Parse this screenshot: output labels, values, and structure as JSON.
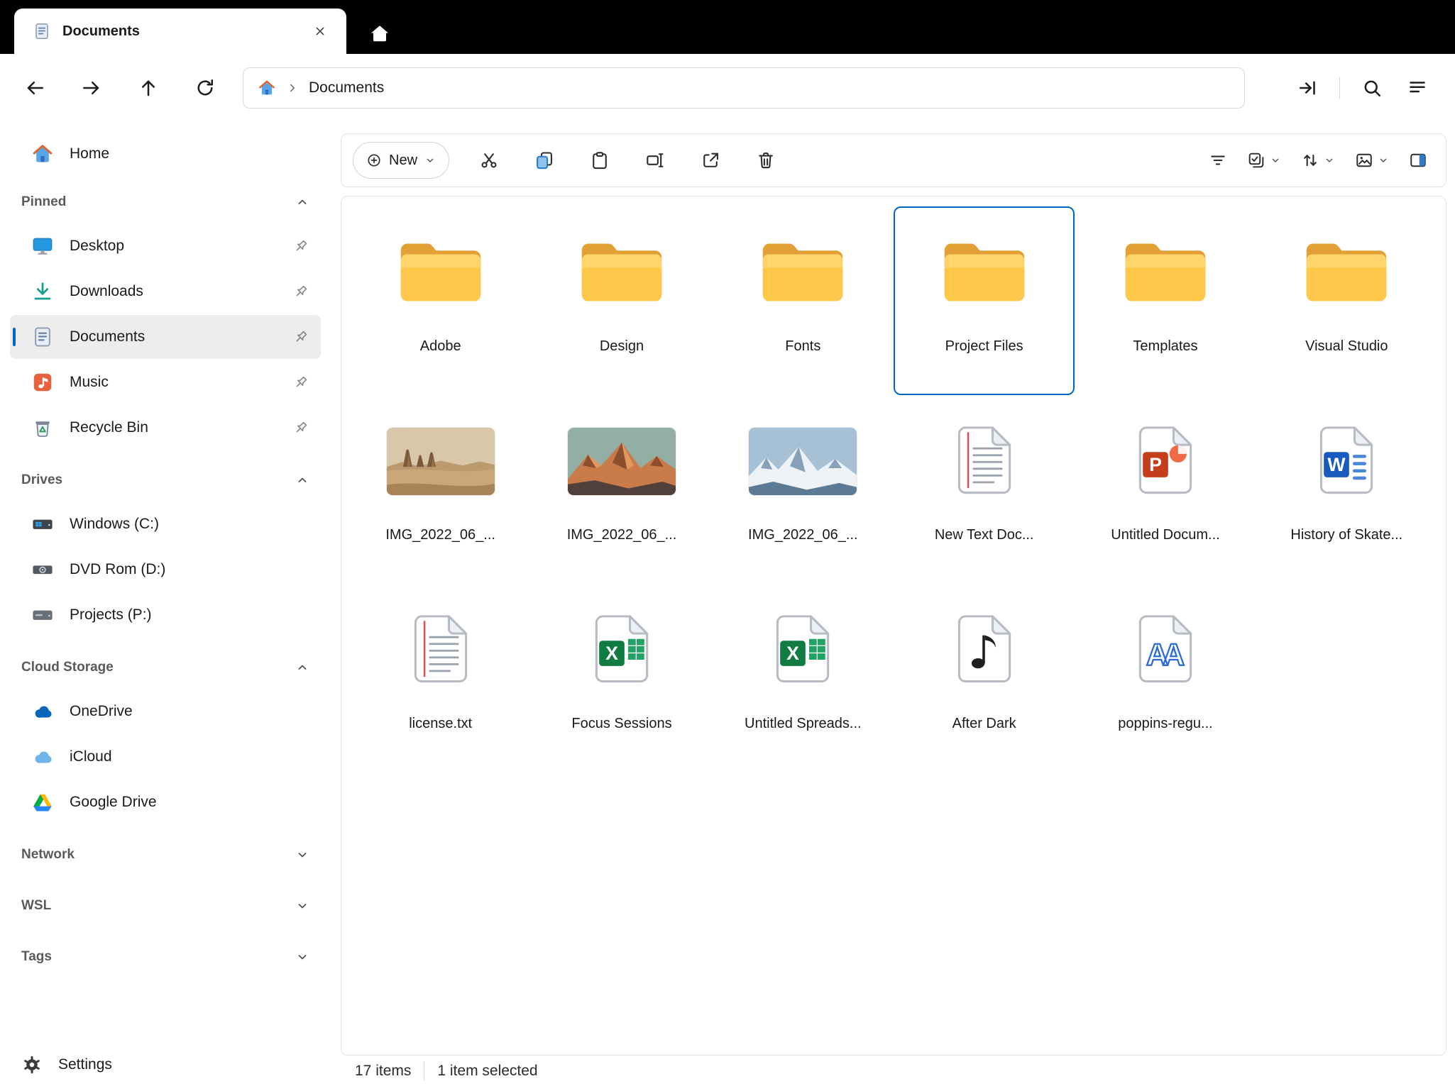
{
  "colors": {
    "titlebar_bg": "#000000",
    "accent": "#0067c0",
    "selection_border": "#0067c0",
    "folder_yellow": "#ffc84a",
    "word_blue": "#185abd",
    "excel_green": "#107c41",
    "powerpoint_orange": "#c43e1c"
  },
  "tab": {
    "title": "Documents"
  },
  "nav": {
    "buttons": [
      "back",
      "forward",
      "up",
      "refresh"
    ],
    "path": "Documents",
    "right_icons": [
      "skip-end",
      "search",
      "document-lines"
    ]
  },
  "sidebar": {
    "home_label": "Home",
    "settings_label": "Settings",
    "sections": [
      {
        "label": "Pinned",
        "expanded": true,
        "items": [
          {
            "name": "Desktop",
            "icon": "desktop",
            "pinned": true
          },
          {
            "name": "Downloads",
            "icon": "downloads",
            "pinned": true
          },
          {
            "name": "Documents",
            "icon": "documents",
            "pinned": true,
            "selected": true
          },
          {
            "name": "Music",
            "icon": "music",
            "pinned": true
          },
          {
            "name": "Recycle Bin",
            "icon": "recycle-bin",
            "pinned": true
          }
        ]
      },
      {
        "label": "Drives",
        "expanded": true,
        "items": [
          {
            "name": "Windows (C:)",
            "icon": "drive-windows"
          },
          {
            "name": "DVD Rom (D:)",
            "icon": "dvd"
          },
          {
            "name": "Projects (P:)",
            "icon": "drive"
          }
        ]
      },
      {
        "label": "Cloud Storage",
        "expanded": true,
        "items": [
          {
            "name": "OneDrive",
            "icon": "onedrive"
          },
          {
            "name": "iCloud",
            "icon": "icloud"
          },
          {
            "name": "Google Drive",
            "icon": "google-drive"
          }
        ]
      },
      {
        "label": "Network",
        "expanded": false,
        "items": []
      },
      {
        "label": "WSL",
        "expanded": false,
        "items": []
      },
      {
        "label": "Tags",
        "expanded": false,
        "items": []
      }
    ]
  },
  "toolbar": {
    "new_label": "New",
    "actions": [
      "cut",
      "copy",
      "paste",
      "rename",
      "share",
      "delete"
    ],
    "view_controls": [
      {
        "icon": "filter",
        "chevron": false
      },
      {
        "icon": "select-options",
        "chevron": true
      },
      {
        "icon": "sort",
        "chevron": true
      },
      {
        "icon": "layout",
        "chevron": true
      },
      {
        "icon": "preview-pane",
        "chevron": false
      }
    ]
  },
  "files": {
    "items": [
      {
        "name": "Adobe",
        "type": "folder"
      },
      {
        "name": "Design",
        "type": "folder"
      },
      {
        "name": "Fonts",
        "type": "folder"
      },
      {
        "name": "Project Files",
        "type": "folder",
        "selected": true
      },
      {
        "name": "Templates",
        "type": "folder"
      },
      {
        "name": "Visual Studio",
        "type": "folder"
      },
      {
        "name": "IMG_2022_06_...",
        "type": "image-desert"
      },
      {
        "name": "IMG_2022_06_...",
        "type": "image-alps"
      },
      {
        "name": "IMG_2022_06_...",
        "type": "image-snow"
      },
      {
        "name": "New Text Doc...",
        "type": "text"
      },
      {
        "name": "Untitled Docum...",
        "type": "powerpoint"
      },
      {
        "name": "History of Skate...",
        "type": "word"
      },
      {
        "name": "license.txt",
        "type": "text"
      },
      {
        "name": "Focus Sessions",
        "type": "excel"
      },
      {
        "name": "Untitled Spreads...",
        "type": "excel"
      },
      {
        "name": "After Dark",
        "type": "audio"
      },
      {
        "name": "poppins-regu...",
        "type": "font"
      }
    ]
  },
  "statusbar": {
    "count": "17 items",
    "selected": "1 item selected"
  }
}
